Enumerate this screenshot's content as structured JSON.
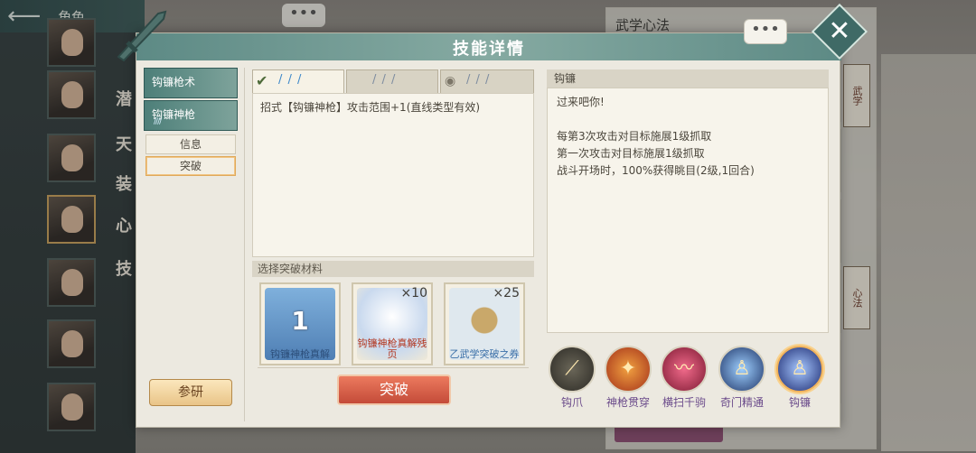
{
  "topbar": {
    "title": "角色"
  },
  "side_nav": {
    "labels": [
      "潜",
      "天",
      "装",
      "心",
      "技"
    ]
  },
  "right_panel": {
    "title": "武学心法",
    "tab_a": "武学",
    "tab_b": "心法"
  },
  "dialog": {
    "title": "技能详情",
    "close_icon": "close-icon",
    "skill_tabs": [
      {
        "label": "钩镰枪术"
      },
      {
        "label": "钩镰神枪",
        "marks": "////"
      }
    ],
    "sub_tabs": [
      {
        "label": "信息",
        "active": false
      },
      {
        "label": "突破",
        "active": true
      }
    ],
    "research_label": "参研",
    "level_tabs": [
      {
        "state": "completed",
        "marks": "/ / /"
      },
      {
        "state": "locked",
        "marks": "/ / /"
      },
      {
        "state": "preview",
        "marks": "/ / /"
      }
    ],
    "effect_text": "招式【钩镰神枪】攻击范围+1(直线类型有效)",
    "materials_header": "选择突破材料",
    "materials": [
      {
        "name": "钩镰神枪真解",
        "count": "1",
        "color": "#5e8fc0"
      },
      {
        "name": "钩镰神枪真解残页",
        "count": "×10",
        "color": "#d8e4f0"
      },
      {
        "name": "乙武学突破之券",
        "count": "×25",
        "color": "#d9e6ef"
      }
    ],
    "breakthrough_label": "突破",
    "detail_header": "钩镰",
    "detail_lines": {
      "line1": "过来吧你!",
      "line2": "每第3次攻击对目标施展1级抓取",
      "line3": "第一次攻击对目标施展1级抓取",
      "line4": "战斗开场时，100%获得眺目(2级,1回合)"
    },
    "skills": [
      {
        "label": "钩爪",
        "color": "#4a4a42"
      },
      {
        "label": "神枪贯穿",
        "color": "#b8421f"
      },
      {
        "label": "横扫千驹",
        "color": "#a8283f"
      },
      {
        "label": "奇门精通",
        "color": "#2b4f8a"
      },
      {
        "label": "钩镰",
        "color": "#2d3f8c",
        "selected": true
      }
    ]
  }
}
